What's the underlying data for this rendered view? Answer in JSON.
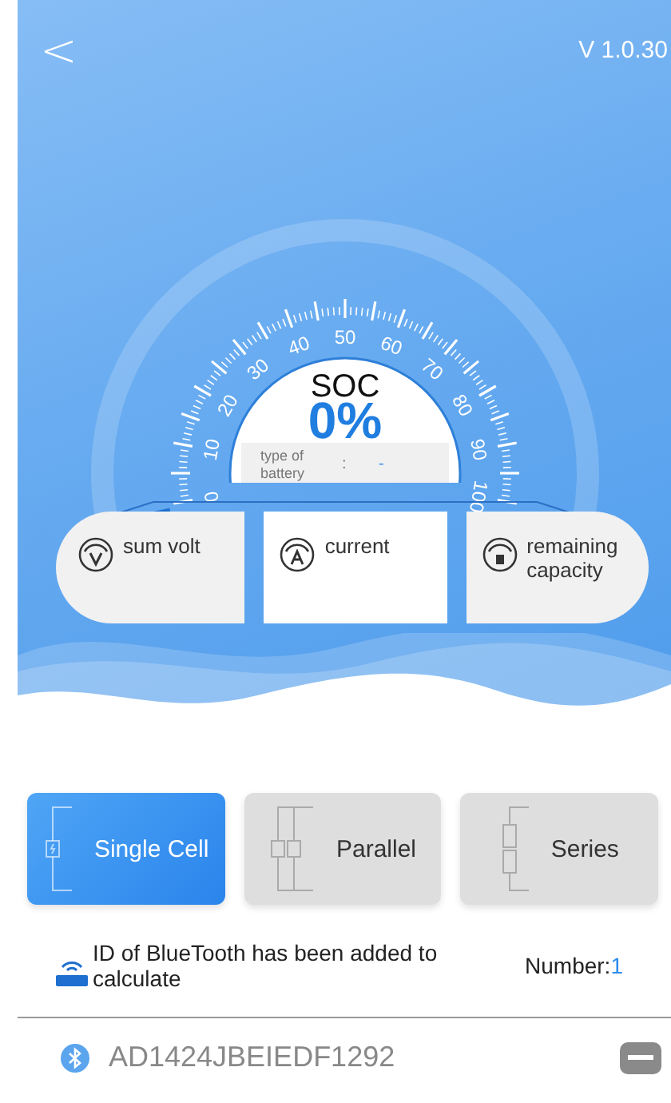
{
  "header": {
    "back": "<",
    "version": "V 1.0.30"
  },
  "gauge": {
    "scale": [
      "0",
      "10",
      "20",
      "30",
      "40",
      "50",
      "60",
      "70",
      "80",
      "90",
      "100"
    ],
    "title": "SOC",
    "value": "0%",
    "battery_type_label": "type of battery",
    "separator": ":",
    "battery_type": "-"
  },
  "metrics": [
    {
      "kind": "volt",
      "label": "sum volt"
    },
    {
      "kind": "current",
      "label": "current"
    },
    {
      "kind": "capacity",
      "label": "remaining capacity"
    }
  ],
  "modes": [
    {
      "kind": "single",
      "label": "Single Cell",
      "selected": true
    },
    {
      "kind": "parallel",
      "label": "Parallel",
      "selected": false
    },
    {
      "kind": "series",
      "label": "Series",
      "selected": false
    }
  ],
  "info": {
    "text": "ID of BlueTooth has been added to calculate",
    "number_label": "Number:",
    "number": "1"
  },
  "devices": [
    {
      "id": "AD1424JBEIEDF1292"
    }
  ]
}
